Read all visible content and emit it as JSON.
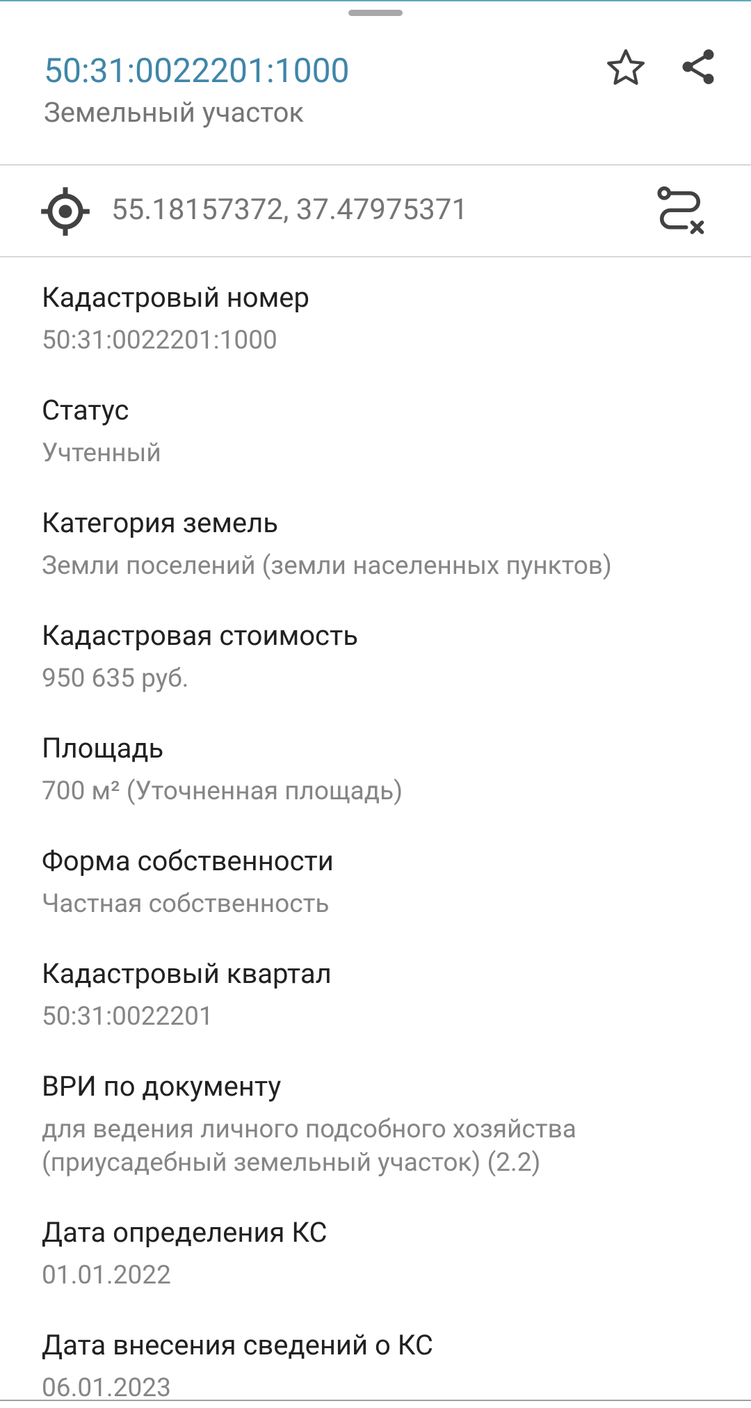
{
  "header": {
    "title": "50:31:0022201:1000",
    "subtitle": "Земельный участок"
  },
  "coordinates": {
    "text": "55.18157372, 37.47975371"
  },
  "colors": {
    "accent": "#3f86a8",
    "label": "#212121",
    "value": "#858585",
    "divider": "#d7d7d7"
  },
  "fields": [
    {
      "label": "Кадастровый номер",
      "value": "50:31:0022201:1000"
    },
    {
      "label": "Статус",
      "value": "Учтенный"
    },
    {
      "label": "Категория земель",
      "value": "Земли поселений (земли населенных пунктов)"
    },
    {
      "label": "Кадастровая стоимость",
      "value": "950 635 руб."
    },
    {
      "label": "Площадь",
      "value": "700 м² (Уточненная площадь)"
    },
    {
      "label": "Форма собственности",
      "value": "Частная собственность"
    },
    {
      "label": "Кадастровый квартал",
      "value": "50:31:0022201"
    },
    {
      "label": "ВРИ по документу",
      "value": "для ведения личного подсобного хозяйства (приусадебный земельный участок) (2.2)"
    },
    {
      "label": "Дата определения КС",
      "value": "01.01.2022"
    },
    {
      "label": "Дата внесения сведений о КС",
      "value": "06.01.2023"
    }
  ],
  "icons": {
    "star": "star-outline-icon",
    "share": "share-icon",
    "target": "gps-target-icon",
    "route": "route-clear-icon"
  }
}
